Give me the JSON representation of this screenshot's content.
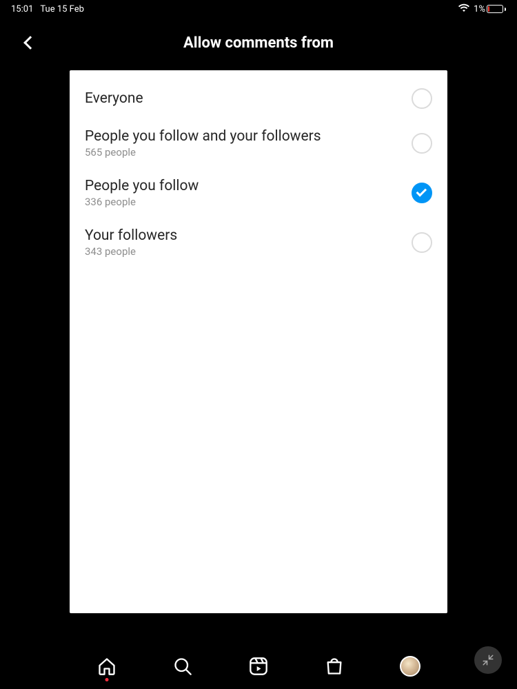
{
  "status": {
    "time": "15:01",
    "date": "Tue 15 Feb",
    "battery_percent": "1%"
  },
  "header": {
    "title": "Allow comments from"
  },
  "options": [
    {
      "label": "Everyone",
      "sub": "",
      "selected": false
    },
    {
      "label": "People you follow and your followers",
      "sub": "565 people",
      "selected": false
    },
    {
      "label": "People you follow",
      "sub": "336 people",
      "selected": true
    },
    {
      "label": "Your followers",
      "sub": "343 people",
      "selected": false
    }
  ],
  "tabs": {
    "home_has_notification": true
  }
}
